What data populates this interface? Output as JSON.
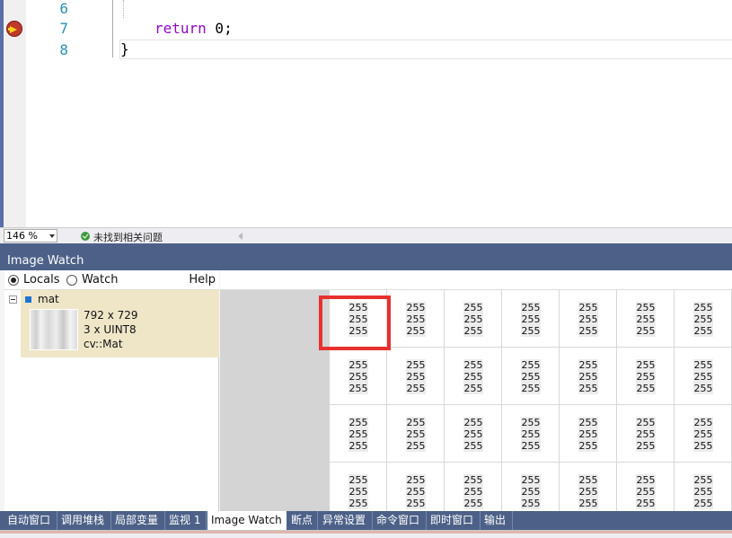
{
  "editor": {
    "lines": [
      {
        "number": "6",
        "text": ""
      },
      {
        "number": "7",
        "keyword": "return",
        "text": " 0;"
      },
      {
        "number": "8",
        "text": "}"
      }
    ]
  },
  "status": {
    "zoom": "146 %",
    "message": "未找到相关问题"
  },
  "image_watch": {
    "title": "Image Watch",
    "options": {
      "locals": "Locals",
      "watch": "Watch",
      "help": "Help",
      "selected": "Locals"
    },
    "variable": {
      "name": "mat",
      "size": "792 x 729",
      "type": "3 x UINT8",
      "class": "cv::Mat"
    },
    "pixel_value": "255",
    "grid_rows": 4,
    "grid_cols": 7
  },
  "tabs": [
    {
      "label": "自动窗口",
      "active": false
    },
    {
      "label": "调用堆栈",
      "active": false
    },
    {
      "label": "局部变量",
      "active": false
    },
    {
      "label": "监视 1",
      "active": false
    },
    {
      "label": "Image Watch",
      "active": true
    },
    {
      "label": "断点",
      "active": false
    },
    {
      "label": "异常设置",
      "active": false
    },
    {
      "label": "命令窗口",
      "active": false
    },
    {
      "label": "即时窗口",
      "active": false
    },
    {
      "label": "输出",
      "active": false
    }
  ],
  "colors": {
    "accent_blue": "#4d6188",
    "highlight_red": "#e8302f",
    "keyword_purple": "#8f08c4",
    "line_number": "#2b91af"
  }
}
